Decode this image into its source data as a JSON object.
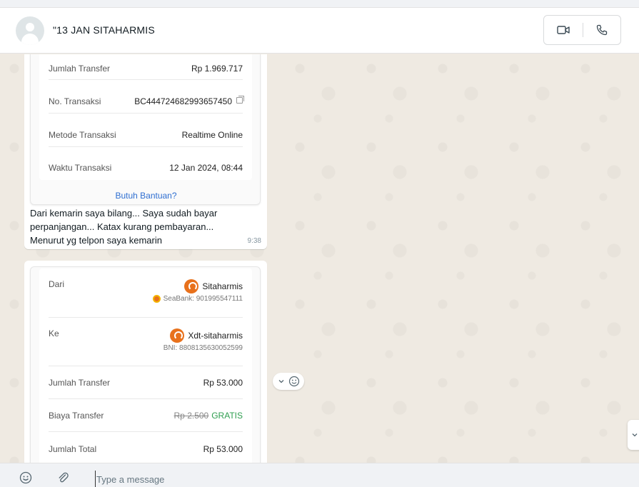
{
  "header": {
    "contact_name": "\"13 JAN SITAHARMIS"
  },
  "receipt1": {
    "rows": [
      {
        "label": "Jumlah Transfer",
        "value": "Rp 1.969.717"
      },
      {
        "label": "No. Transaksi",
        "value": "BC444724682993657450"
      },
      {
        "label": "Metode Transaksi",
        "value": "Realtime Online"
      },
      {
        "label": "Waktu Transaksi",
        "value": "12 Jan 2024, 08:44"
      }
    ],
    "help_link": "Butuh Bantuan?"
  },
  "message1": {
    "text": "Dari kemarin saya bilang... Saya sudah bayar perpanjangan... Katax kurang pembayaran... Menurut yg telpon saya kemarin",
    "time": "9:38"
  },
  "receipt2": {
    "from_label": "Dari",
    "from_name": "Sitaharmis",
    "from_account": "SeaBank: 901995547111",
    "to_label": "Ke",
    "to_name": "Xdt-sitaharmis",
    "to_account": "BNI: 8808135630052599",
    "amount_label": "Jumlah Transfer",
    "amount_value": "Rp 53.000",
    "fee_label": "Biaya Transfer",
    "fee_original": "Rp 2.500",
    "fee_value": "GRATIS",
    "total_label": "Jumlah Total",
    "total_value": "Rp 53.000"
  },
  "composer": {
    "placeholder": "Type a message"
  },
  "icons": {
    "video": "video-camera-icon",
    "phone": "phone-icon",
    "emoji": "emoji-icon",
    "attach": "paperclip-icon",
    "react": "smiley-icon",
    "chevron": "chevron-down-icon"
  },
  "colors": {
    "chat_background": "#efeae2",
    "bubble": "#ffffff",
    "link": "#2f6fd1",
    "free_green": "#2e9e4f",
    "brand_orange": "#e8711c"
  }
}
